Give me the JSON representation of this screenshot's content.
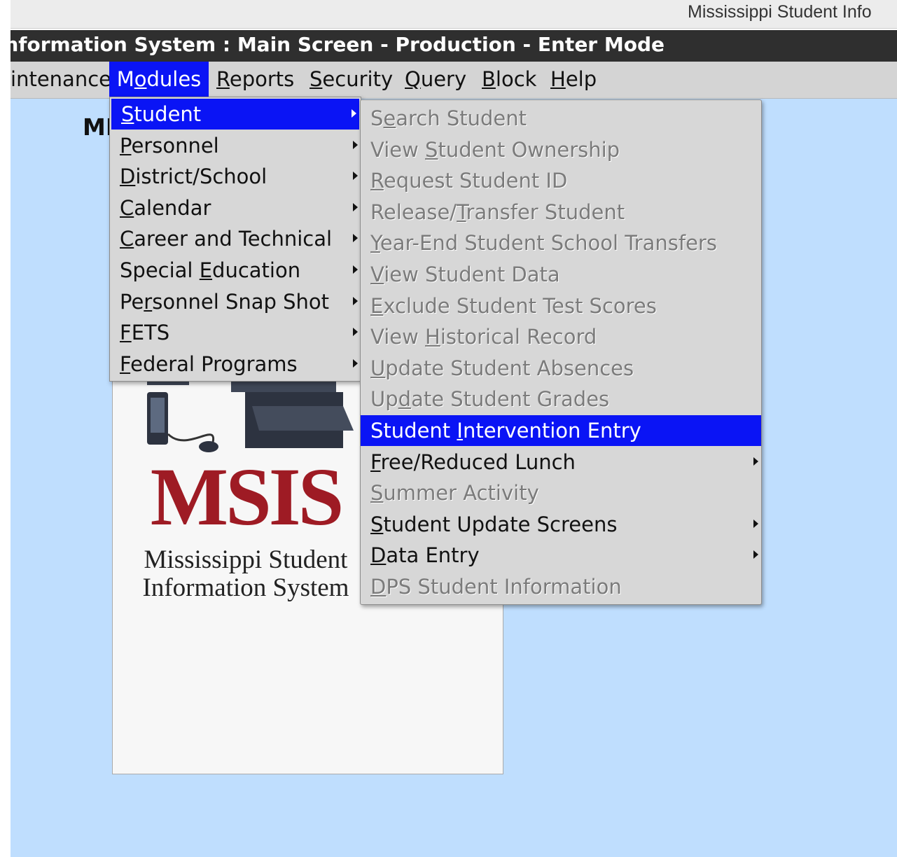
{
  "os_window_title": "Mississippi Student Info",
  "app_title": "Mississippi Student Information System : Main Screen  -  Production  -  Enter Mode",
  "menubar": [
    {
      "label": "Maintenance",
      "mnemonic_index": 1
    },
    {
      "label": "Modules",
      "mnemonic_index": 1,
      "active": true
    },
    {
      "label": "Reports",
      "mnemonic_index": 0
    },
    {
      "label": "Security",
      "mnemonic_index": 0
    },
    {
      "label": "Query",
      "mnemonic_index": 0
    },
    {
      "label": "Block",
      "mnemonic_index": 0
    },
    {
      "label": "Help",
      "mnemonic_index": 0
    }
  ],
  "welcome_label": "MI",
  "modules_menu": [
    {
      "label": "Student",
      "mnemonic_index": 0,
      "submenu": true,
      "selected": true
    },
    {
      "label": "Personnel",
      "mnemonic_index": 0,
      "submenu": true
    },
    {
      "label": "District/School",
      "mnemonic_index": 0,
      "submenu": true
    },
    {
      "label": "Calendar",
      "mnemonic_index": 0,
      "submenu": true
    },
    {
      "label": "Career and Technical",
      "mnemonic_index": 0,
      "submenu": true
    },
    {
      "label": "Special Education",
      "mnemonic_index": 8,
      "submenu": true
    },
    {
      "label": "Personnel Snap Shot",
      "mnemonic_index": 2,
      "submenu": true
    },
    {
      "label": "FETS",
      "mnemonic_index": 0,
      "submenu": true
    },
    {
      "label": "Federal Programs",
      "mnemonic_index": 0,
      "submenu": true
    }
  ],
  "student_menu": [
    {
      "label": "Search Student",
      "mnemonic_index": 1,
      "enabled": false
    },
    {
      "label": "View Student Ownership",
      "mnemonic_index": 5,
      "enabled": false
    },
    {
      "label": "Request Student ID",
      "mnemonic_index": 0,
      "enabled": false
    },
    {
      "label": "Release/Transfer Student",
      "mnemonic_index": 8,
      "enabled": false
    },
    {
      "label": "Year-End Student School Transfers",
      "mnemonic_index": 0,
      "enabled": false
    },
    {
      "label": "View Student Data",
      "mnemonic_index": 0,
      "enabled": false
    },
    {
      "label": "Exclude Student Test Scores",
      "mnemonic_index": 0,
      "enabled": false
    },
    {
      "label": "View Historical Record",
      "mnemonic_index": 5,
      "enabled": false
    },
    {
      "label": "Update Student Absences",
      "mnemonic_index": 0,
      "enabled": false
    },
    {
      "label": "Update Student Grades",
      "mnemonic_index": 2,
      "enabled": false
    },
    {
      "label": "Student Intervention Entry",
      "mnemonic_index": 8,
      "enabled": true,
      "selected": true
    },
    {
      "label": "Free/Reduced Lunch",
      "mnemonic_index": 0,
      "enabled": true,
      "submenu": true
    },
    {
      "label": "Summer Activity",
      "mnemonic_index": 0,
      "enabled": false
    },
    {
      "label": "Student Update Screens",
      "mnemonic_index": 0,
      "enabled": true,
      "submenu": true
    },
    {
      "label": "Data Entry",
      "mnemonic_index": 0,
      "enabled": true,
      "submenu": true
    },
    {
      "label": "DPS Student Information",
      "mnemonic_index": 0,
      "enabled": false
    }
  ],
  "logo": {
    "wordmark": "MSIS",
    "line1": "Mississippi Student",
    "line2": "Information System"
  },
  "colors": {
    "selection": "#0a14f5",
    "workspace": "#bfdefe",
    "menu_bg": "#d7d7d7",
    "logo_red": "#9e1b24"
  }
}
